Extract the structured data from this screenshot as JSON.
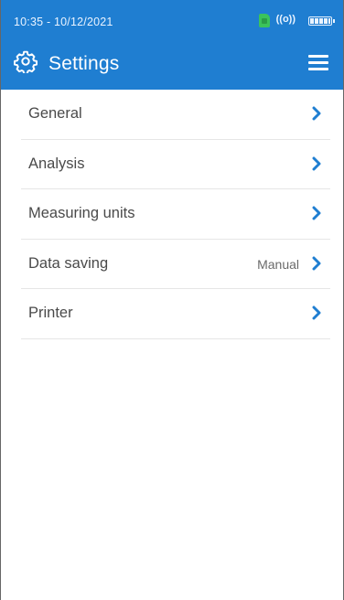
{
  "status": {
    "time": "10:35 - 10/12/2021",
    "icons": [
      "sim-icon",
      "wireless-signal-icon",
      "battery-icon"
    ],
    "signal_text": "((o))"
  },
  "appbar": {
    "title": "Settings",
    "left_icon": "gear-icon",
    "right_icon": "hamburger-menu-icon"
  },
  "settings": {
    "items": [
      {
        "label": "General",
        "value": ""
      },
      {
        "label": "Analysis",
        "value": ""
      },
      {
        "label": "Measuring units",
        "value": ""
      },
      {
        "label": "Data saving",
        "value": "Manual"
      },
      {
        "label": "Printer",
        "value": ""
      }
    ]
  },
  "colors": {
    "primary": "#1f7ed1",
    "accent_chevron": "#1f7ed1",
    "text": "#4a4a4a",
    "divider": "#e6e6e6",
    "sim_green": "#3bc35b"
  }
}
